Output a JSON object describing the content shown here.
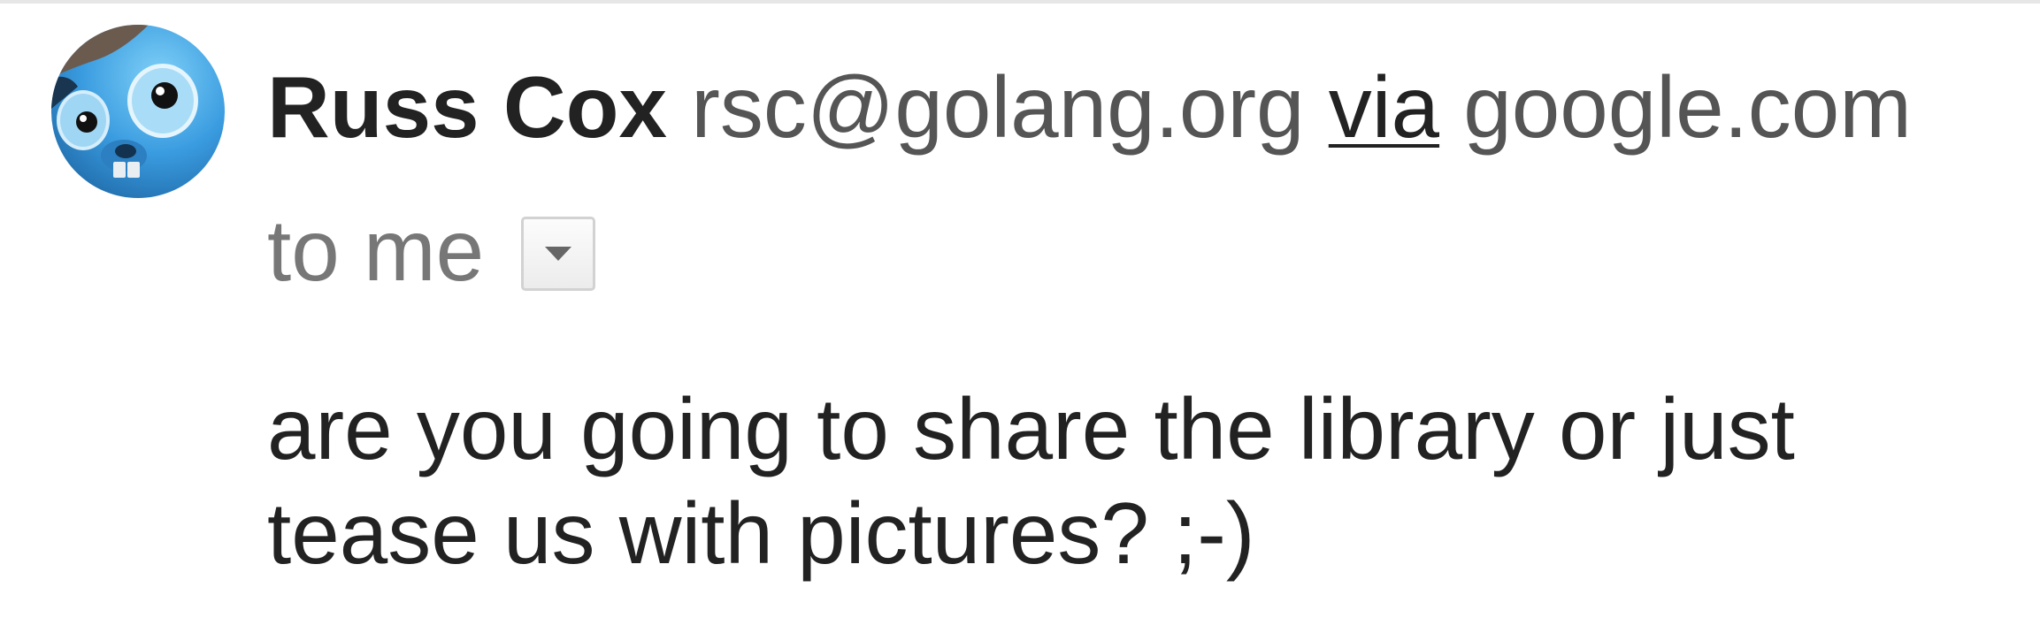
{
  "message": {
    "sender": {
      "name": "Russ Cox",
      "email": "rsc@golang.org",
      "via_label": "via",
      "via_domain": "google.com"
    },
    "recipient": {
      "label": "to me"
    },
    "body": "are you going to share the library or just\ntease us with pictures?  ;-)"
  },
  "icons": {
    "avatar": "gopher-avatar-icon",
    "details_toggle": "caret-down-icon"
  },
  "colors": {
    "sender_name": "#222222",
    "secondary_text": "#555555",
    "recipient_text": "#777777",
    "avatar_blue": "#3a9ce0"
  }
}
